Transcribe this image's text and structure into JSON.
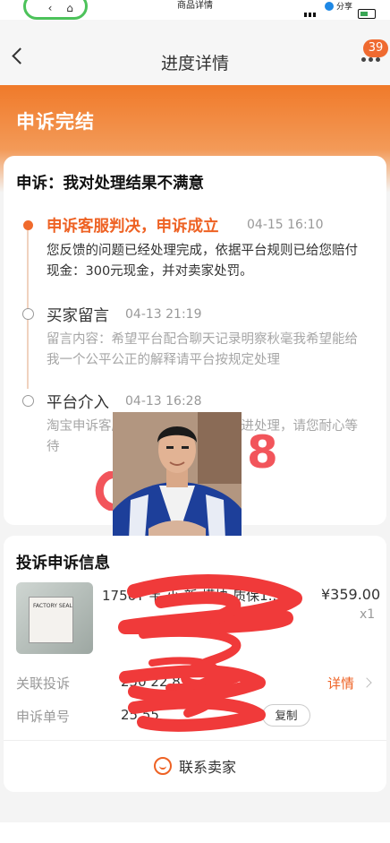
{
  "status_bar": {
    "page_title": "商品详情",
    "share_label": "分享"
  },
  "header": {
    "title": "进度详情",
    "badge_count": "39"
  },
  "hero": {
    "title": "申诉完结"
  },
  "appeal": {
    "heading": "申诉：我对处理结果不满意",
    "steps": [
      {
        "title": "申诉客服判决，申诉成立",
        "time": "04-15 16:10",
        "body": "您反馈的问题已经处理完成，依据平台规则已给您赔付现金：300元现金，并对卖家处罚。"
      },
      {
        "title": "买家留言",
        "time": "04-13 21:19",
        "body": "留言内容：希望平台配合聊天记录明察秋毫我希望能给我一个公平公正的解释请平台按规定处理"
      },
      {
        "title": "平台介入",
        "time": "04-13 16:28",
        "body": "淘宝申诉客服已介入，将在时内跟进处理，请您耐心等待"
      }
    ],
    "overlay_digit": "8"
  },
  "complaint_info": {
    "heading": "投诉申诉信息",
    "product": {
      "name": "1756T 韦 小 新 模块 质保1...",
      "price": "¥359.00",
      "qty": "x1",
      "box_label": "FACTORY SEAL"
    },
    "related_label": "关联投诉",
    "related_value": "250 22 82",
    "detail_label": "详情",
    "order_label": "申诉单号",
    "order_value": "25 55",
    "copy_label": "复制",
    "contact_label": "联系卖家"
  },
  "colors": {
    "accent": "#ee6224",
    "scribble": "#f03a3a"
  }
}
